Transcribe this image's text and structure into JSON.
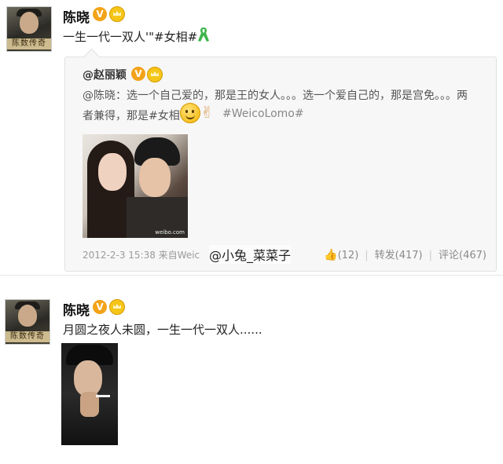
{
  "post1": {
    "avatar_caption": "陈数传奇",
    "username": "陈晓",
    "v_badge": "V",
    "text": "一生一代一双人'\"#女相#",
    "repost": {
      "username": "@赵丽颖",
      "line1": "@陈晓：选一个自己爱的，那是王的女人。。。选一个爱自己的，那是宫免。。。两",
      "line2_prefix": "者兼得，那是#女相#",
      "line2_tag": "#WeicoLomo#",
      "photo_watermark": "weibo.com",
      "footer": "2012-2-3 15:38  来自Weic",
      "likes": "(12)",
      "repost_label": "转发(417)",
      "comment_label": "评论(467)"
    },
    "watermark": "@小兔_菜菜子"
  },
  "post2": {
    "avatar_caption": "陈数传奇",
    "username": "陈晓",
    "v_badge": "V",
    "text": "月圆之夜人未圆，一生一代一双人......"
  },
  "icons": {
    "like": "thumbs-up-icon",
    "ribbon": "green-ribbon-icon",
    "smiley": "smiley-emoji-icon",
    "victory": "victory-hand-icon",
    "crown": "crown-badge-icon"
  },
  "colors": {
    "vip_orange": "#f3a319",
    "like_blue": "#3d8fd6",
    "ribbon_green": "#3bb54a"
  }
}
